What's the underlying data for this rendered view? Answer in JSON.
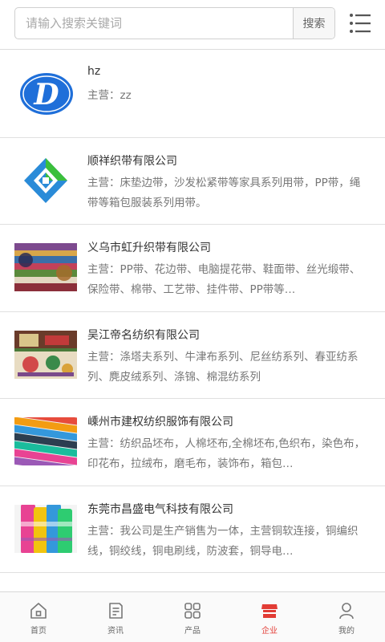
{
  "search": {
    "placeholder": "请输入搜索关键词",
    "button_label": "搜索"
  },
  "menu": {
    "icon": "list-menu-icon"
  },
  "companies": [
    {
      "name": "hz",
      "desc": "主营：zz",
      "thumb": "logo-d-blue"
    },
    {
      "name": "顺祥织带有限公司",
      "desc": "主营：床垫边带，沙发松紧带等家具系列用带，PP带，绳带等箱包服装系列用带。",
      "thumb": "logo-green-blue-diamond"
    },
    {
      "name": "义乌市虹升织带有限公司",
      "desc": "主营：PP带、花边带、电脑提花带、鞋面带、丝光缎带、保险带、棉带、工艺带、挂件带、PP带等…",
      "thumb": "photo-ribbons"
    },
    {
      "name": "吴江帝名纺织有限公司",
      "desc": "主营：涤塔夫系列、牛津布系列、尼丝纺系列、春亚纺系列、麂皮绒系列、涤锦、棉混纺系列",
      "thumb": "photo-fabric"
    },
    {
      "name": "嵊州市建权纺织服饰有限公司",
      "desc": "主营：纺织品坯布，人棉坯布,全棉坯布,色织布，染色布，印花布，拉绒布，磨毛布，装饰布，箱包…",
      "thumb": "photo-webbing"
    },
    {
      "name": "东莞市昌盛电气科技有限公司",
      "desc": "主营：我公司是生产销售为一体，主营铜软连接，铜编织线，铜绞线，铜电刷线，防波套，铜导电…",
      "thumb": "photo-spools"
    }
  ],
  "bottom_nav": [
    {
      "label": "首页",
      "icon": "home-icon",
      "active": false
    },
    {
      "label": "资讯",
      "icon": "news-icon",
      "active": false
    },
    {
      "label": "产品",
      "icon": "grid-icon",
      "active": false
    },
    {
      "label": "企业",
      "icon": "store-icon",
      "active": true
    },
    {
      "label": "我的",
      "icon": "user-icon",
      "active": false
    }
  ],
  "colors": {
    "accent": "#e23c35",
    "logo_blue": "#1f6fd9",
    "logo_green": "#3bbf3b",
    "border": "#e0e0e0"
  }
}
